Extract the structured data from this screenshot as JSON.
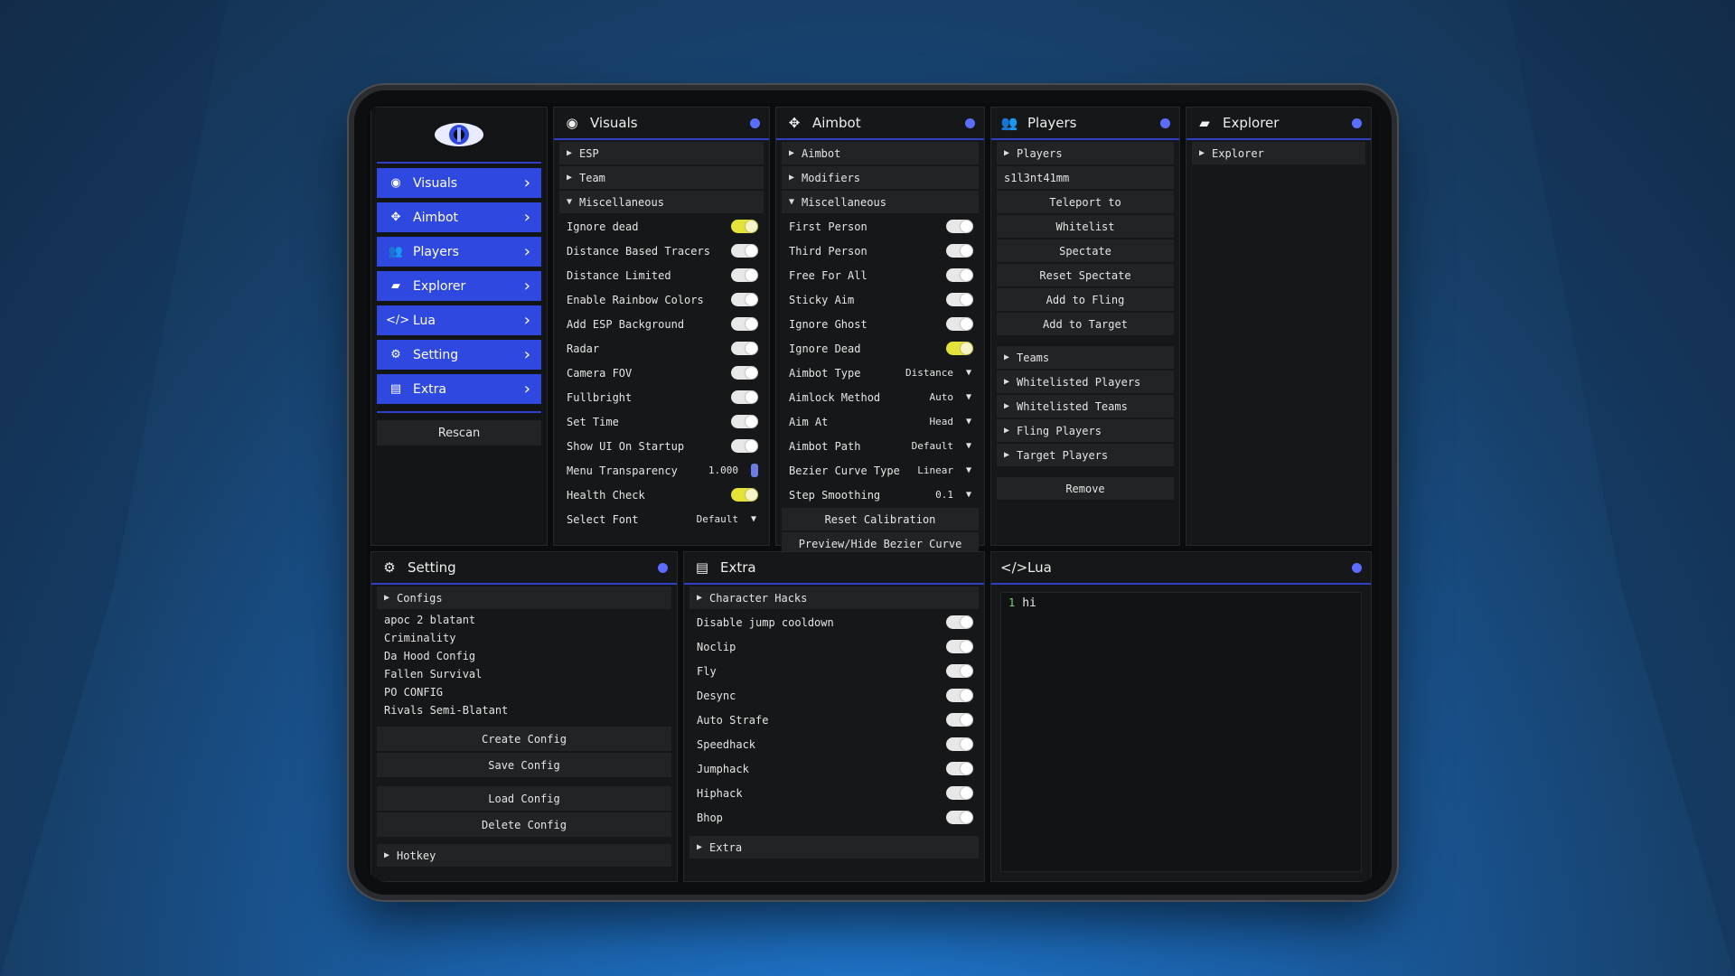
{
  "colors": {
    "accent": "#2f49e0",
    "toggle_on": "#e4e33a",
    "dot": "#5a6dff"
  },
  "sidebar": {
    "logo": "eye-logo",
    "items": [
      {
        "label": "Visuals",
        "icon": "eye-icon"
      },
      {
        "label": "Aimbot",
        "icon": "crosshair-icon"
      },
      {
        "label": "Players",
        "icon": "players-icon"
      },
      {
        "label": "Explorer",
        "icon": "folder-icon"
      },
      {
        "label": "Lua",
        "icon": "code-icon"
      },
      {
        "label": "Setting",
        "icon": "gear-icon"
      },
      {
        "label": "Extra",
        "icon": "file-icon"
      }
    ],
    "rescan": "Rescan"
  },
  "visuals": {
    "title": "Visuals",
    "sections": [
      "ESP",
      "Team",
      "Miscellaneous"
    ],
    "toggles": [
      {
        "label": "Ignore dead",
        "on": true
      },
      {
        "label": "Distance Based Tracers",
        "on": false
      },
      {
        "label": "Distance Limited",
        "on": false
      },
      {
        "label": "Enable Rainbow Colors",
        "on": false
      },
      {
        "label": "Add ESP Background",
        "on": false
      },
      {
        "label": "Radar",
        "on": false
      },
      {
        "label": "Camera FOV",
        "on": false
      },
      {
        "label": "Fullbright",
        "on": false
      },
      {
        "label": "Set Time",
        "on": false
      },
      {
        "label": "Show UI On Startup",
        "on": false
      }
    ],
    "menu_transparency": {
      "label": "Menu Transparency",
      "value": "1.000"
    },
    "health_check": {
      "label": "Health Check",
      "on": true
    },
    "select_font": {
      "label": "Select Font",
      "value": "Default"
    }
  },
  "aimbot": {
    "title": "Aimbot",
    "sections": [
      "Aimbot",
      "Modifiers",
      "Miscellaneous"
    ],
    "toggles": [
      {
        "label": "First Person",
        "on": false
      },
      {
        "label": "Third Person",
        "on": false
      },
      {
        "label": "Free For All",
        "on": false
      },
      {
        "label": "Sticky Aim",
        "on": false
      },
      {
        "label": "Ignore Ghost",
        "on": false
      },
      {
        "label": "Ignore Dead",
        "on": true
      }
    ],
    "dropdowns": [
      {
        "label": "Aimbot Type",
        "value": "Distance"
      },
      {
        "label": "Aimlock Method",
        "value": "Auto"
      },
      {
        "label": "Aim At",
        "value": "Head"
      },
      {
        "label": "Aimbot Path",
        "value": "Default"
      },
      {
        "label": "Bezier Curve Type",
        "value": "Linear"
      },
      {
        "label": "Step Smoothing",
        "value": "0.1"
      }
    ],
    "buttons": [
      "Reset Calibration",
      "Preview/Hide Bezier Curve"
    ]
  },
  "players": {
    "title": "Players",
    "section": "Players",
    "selected": "s1l3nt41mm",
    "buttons": [
      "Teleport to",
      "Whitelist",
      "Spectate",
      "Reset Spectate",
      "Add to Fling",
      "Add to Target"
    ],
    "lists": [
      "Teams",
      "Whitelisted Players",
      "Whitelisted Teams",
      "Fling Players",
      "Target Players"
    ],
    "remove": "Remove"
  },
  "explorer": {
    "title": "Explorer",
    "section": "Explorer"
  },
  "setting": {
    "title": "Setting",
    "configs_label": "Configs",
    "configs": [
      "apoc 2 blatant",
      "Criminality",
      "Da Hood Config",
      "Fallen Survival",
      "PO CONFIG",
      "Rivals Semi-Blatant"
    ],
    "buttons": [
      "Create Config",
      "Save Config",
      "Load Config",
      "Delete Config"
    ],
    "hotkey": "Hotkey"
  },
  "extra": {
    "title": "Extra",
    "section": "Character Hacks",
    "toggles": [
      {
        "label": "Disable jump cooldown",
        "on": false
      },
      {
        "label": "Noclip",
        "on": false
      },
      {
        "label": "Fly",
        "on": false
      },
      {
        "label": "Desync",
        "on": false
      },
      {
        "label": "Auto Strafe",
        "on": false
      },
      {
        "label": "Speedhack",
        "on": false
      },
      {
        "label": "Jumphack",
        "on": false
      },
      {
        "label": "Hiphack",
        "on": false
      },
      {
        "label": "Bhop",
        "on": false
      }
    ],
    "footer_section": "Extra"
  },
  "lua": {
    "title": "Lua",
    "line_number": "1",
    "code": "hi"
  }
}
